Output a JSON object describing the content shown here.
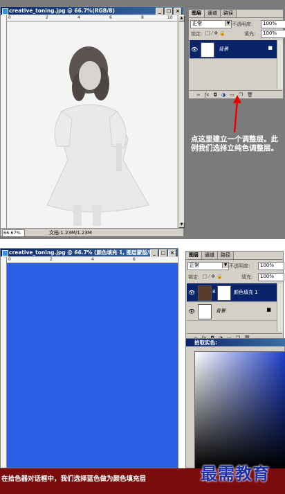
{
  "window1": {
    "title": "creative_toning.jpg @ 66.7%(RGB/8)",
    "zoom": "66.67%",
    "doc_info": "文档:1.23M/1.23M",
    "ruler_ticks": [
      "0",
      "2",
      "4",
      "6",
      "8",
      "10"
    ]
  },
  "layers_panel1": {
    "tabs": [
      "图层",
      "通道",
      "路径"
    ],
    "blend_mode": "正常",
    "opacity_label": "不透明度:",
    "opacity_value": "100%",
    "lock_label": "锁定:",
    "fill_label": "填充:",
    "fill_value": "100%",
    "layer_name": "背景"
  },
  "annotation": "点这里建立一个调整层。此例我们选择立纯色调整层。",
  "window2": {
    "title": "creative_toning.jpg @ 66.7% (颜色填充 1, 图层蒙版/8)",
    "ruler_ticks": [
      "0",
      "2",
      "4",
      "6"
    ],
    "canvas_color": "#2a5fe6"
  },
  "layers_panel2": {
    "tabs": [
      "图层",
      "通道",
      "路径"
    ],
    "blend_mode": "正常",
    "opacity_label": "不透明度:",
    "opacity_value": "100%",
    "lock_label": "锁定:",
    "fill_label": "填充:",
    "fill_value": "100%",
    "layer1_name": "颜色填充 1",
    "layer1_color": "#5a3a28",
    "layer2_name": "背景"
  },
  "color_picker": {
    "title": "拾取实色:"
  },
  "bottom_caption": "在拾色器对话框中，我们选择蓝色做为颜色填充层",
  "watermark": "最需教育",
  "colors": {
    "gray_bg": "#7b7b7b",
    "banner": "#7a0b0b",
    "selected_layer": "#0a246a"
  }
}
